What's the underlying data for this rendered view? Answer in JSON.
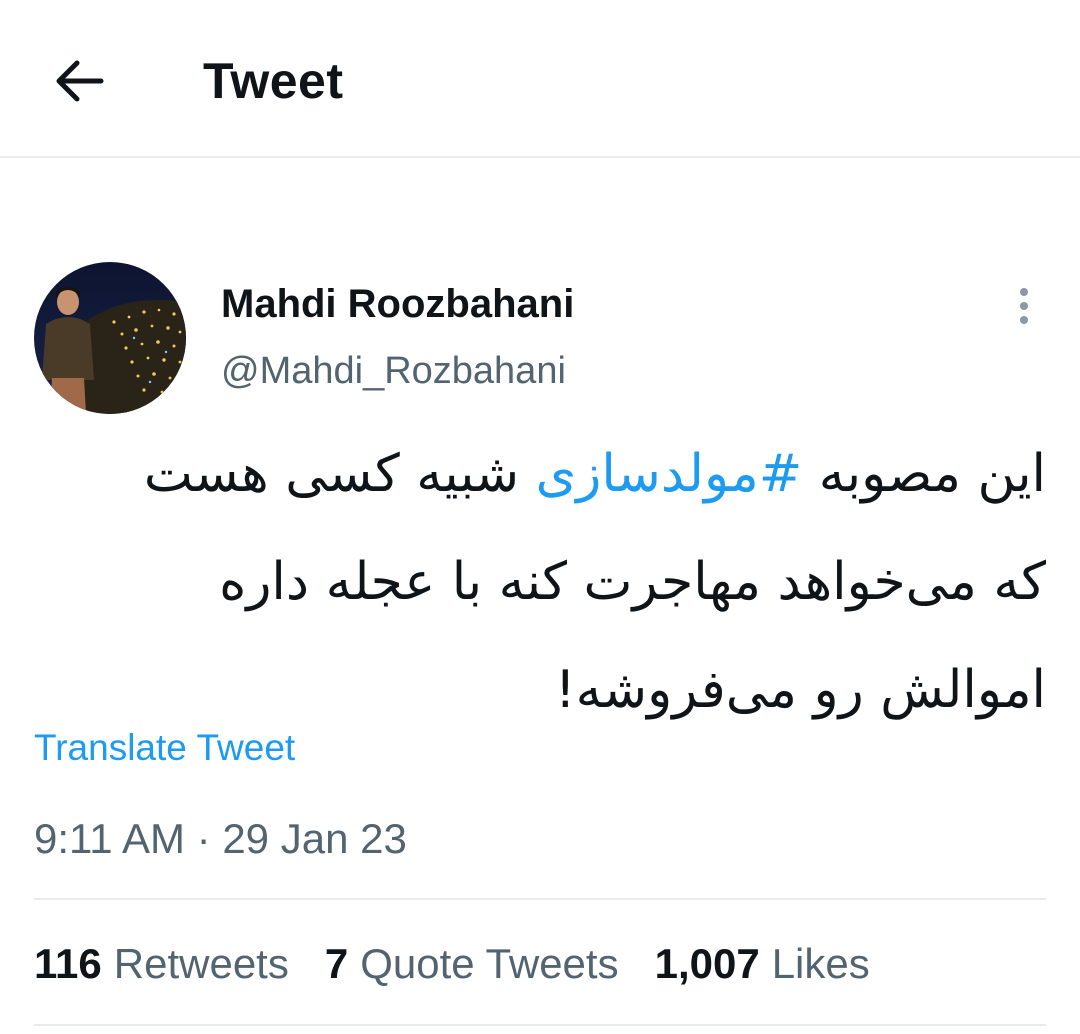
{
  "header": {
    "title": "Tweet",
    "back_icon": "arrow-left-icon"
  },
  "author": {
    "name": "Mahdi Roozbahani",
    "handle": "@Mahdi_Rozbahani",
    "more_icon": "more-vertical-icon"
  },
  "tweet": {
    "line1_pre": "این مصوبه ",
    "hashtag": "#مولدسازی",
    "line1_post": " شبیه کسی هست",
    "line2": "که می‌خواهد مهاجرت کنه با عجله داره",
    "line3": "اموالش رو می‌فروشه!",
    "translate_label": "Translate Tweet",
    "time": "9:11 AM",
    "separator": "·",
    "date": "29 Jan 23"
  },
  "stats": {
    "retweets_count": "116",
    "retweets_label": "Retweets",
    "quotes_count": "7",
    "quotes_label": "Quote Tweets",
    "likes_count": "1,007",
    "likes_label": "Likes"
  },
  "colors": {
    "accent": "#1d9bf0",
    "text": "#0f1419",
    "secondary": "#536471",
    "divider": "#e6ecf0"
  }
}
